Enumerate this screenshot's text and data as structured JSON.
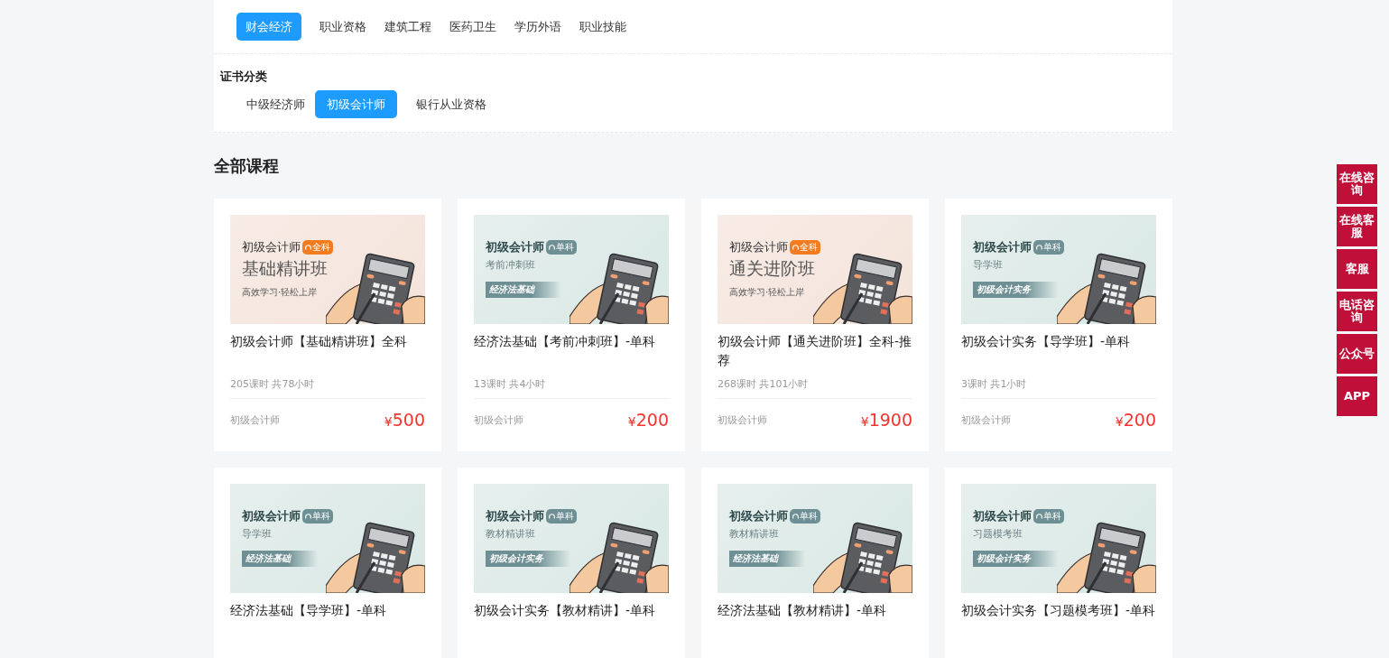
{
  "category_tabs": [
    {
      "label": "财会经济",
      "selected": true
    },
    {
      "label": "职业资格",
      "selected": false
    },
    {
      "label": "建筑工程",
      "selected": false
    },
    {
      "label": "医药卫生",
      "selected": false
    },
    {
      "label": "学历外语",
      "selected": false
    },
    {
      "label": "职业技能",
      "selected": false
    }
  ],
  "certificate_filter": {
    "title": "证书分类",
    "tabs": [
      {
        "label": "中级经济师",
        "selected": false
      },
      {
        "label": "初级会计师",
        "selected": true
      },
      {
        "label": "银行从业资格",
        "selected": false
      }
    ]
  },
  "section_title": "全部课程",
  "courses": [
    {
      "banner": {
        "kind": "warm",
        "title": "初级会计师",
        "badge": "全科",
        "subtitle": "基础精讲班",
        "tagline": "高效学习·轻松上岸"
      },
      "name": "初级会计师【基础精讲班】全科",
      "meta": "205课时 共78小时",
      "category": "初级会计师",
      "currency": "¥",
      "price": "500"
    },
    {
      "banner": {
        "kind": "cool",
        "title": "初级会计师",
        "badge": "单科",
        "subtitle": "考前冲刺班",
        "tagline": "经济法基础"
      },
      "name": "经济法基础【考前冲刺班】-单科",
      "meta": "13课时 共4小时",
      "category": "初级会计师",
      "currency": "¥",
      "price": "200"
    },
    {
      "banner": {
        "kind": "warm",
        "title": "初级会计师",
        "badge": "全科",
        "subtitle": "通关进阶班",
        "tagline": "高效学习·轻松上岸"
      },
      "name": "初级会计师【通关进阶班】全科-推荐",
      "meta": "268课时 共101小时",
      "category": "初级会计师",
      "currency": "¥",
      "price": "1900"
    },
    {
      "banner": {
        "kind": "cool",
        "title": "初级会计师",
        "badge": "单科",
        "subtitle": "导学班",
        "tagline": "初级会计实务"
      },
      "name": "初级会计实务【导学班】-单科",
      "meta": "3课时 共1小时",
      "category": "初级会计师",
      "currency": "¥",
      "price": "200"
    },
    {
      "banner": {
        "kind": "cool",
        "title": "初级会计师",
        "badge": "单科",
        "subtitle": "导学班",
        "tagline": "经济法基础"
      },
      "name": "经济法基础【导学班】-单科"
    },
    {
      "banner": {
        "kind": "cool",
        "title": "初级会计师",
        "badge": "单科",
        "subtitle": "教材精讲班",
        "tagline": "初级会计实务"
      },
      "name": "初级会计实务【教材精讲】-单科"
    },
    {
      "banner": {
        "kind": "cool",
        "title": "初级会计师",
        "badge": "单科",
        "subtitle": "教材精讲班",
        "tagline": "经济法基础"
      },
      "name": "经济法基础【教材精讲】-单科"
    },
    {
      "banner": {
        "kind": "cool",
        "title": "初级会计师",
        "badge": "单科",
        "subtitle": "习题模考班",
        "tagline": "初级会计实务"
      },
      "name": "初级会计实务【习题模考班】-单科"
    }
  ],
  "side_buttons": [
    "在线咨询",
    "在线客服",
    "客服",
    "电话咨询",
    "公众号",
    "APP"
  ]
}
